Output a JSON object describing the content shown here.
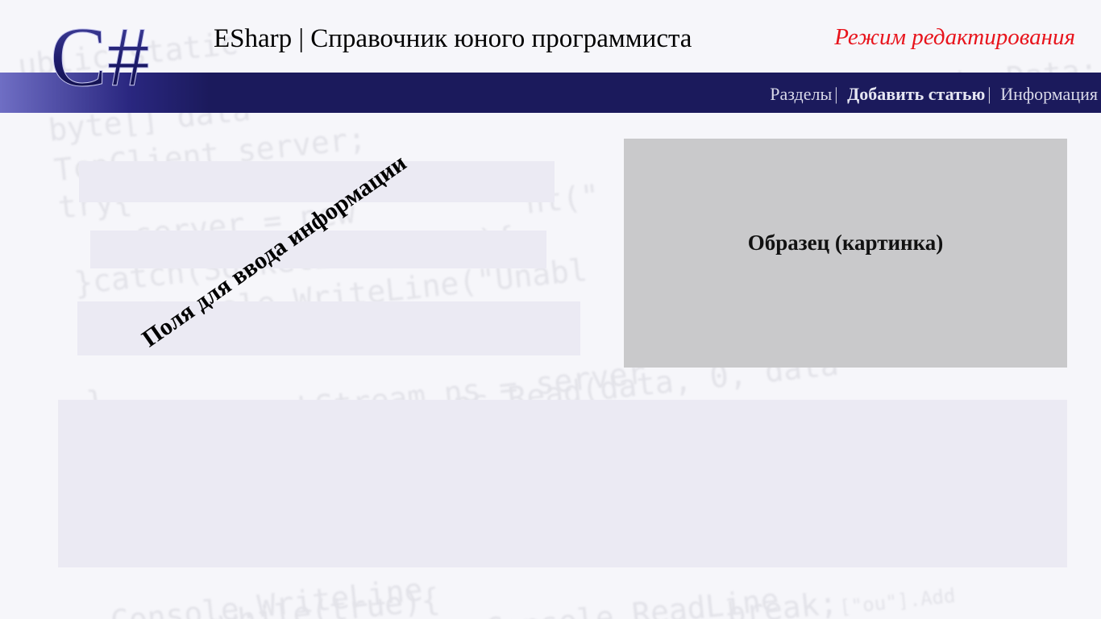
{
  "header": {
    "logo_text": "C#",
    "site_title": "ESharp | Справочник юного программиста",
    "mode_label": "Режим редактирования"
  },
  "nav": {
    "items": [
      {
        "label": "Разделы",
        "active": false
      },
      {
        "label": "Добавить статью",
        "active": true
      },
      {
        "label": "Информация",
        "active": false
      }
    ],
    "separator": "|"
  },
  "main": {
    "sample_image_label": "Образец (картинка)",
    "fields_label": "Поля для ввода информации"
  },
  "background_code": {
    "lines": [
      "ublic static",
      "byte[] data",
      "TcpClient server;",
      "try{",
      "server = new",
      "}catch(SocketException){",
      "Console.WriteLine(\"Unabl",
      "}",
      "NetworkStream ns = server",
      "ns.Read(data, 0, data",
      "Console.WriteLine",
      "while(true){",
      "Console.ReadLine",
      "break;",
      "stringData;",
      "nt(\"",
      "[\"ou\"].Add"
    ]
  },
  "colors": {
    "navbar": "#1b1a5c",
    "mode_label": "#e8141c",
    "field_bg": "#ebeaf3",
    "sample_bg": "#c9c9cb"
  }
}
